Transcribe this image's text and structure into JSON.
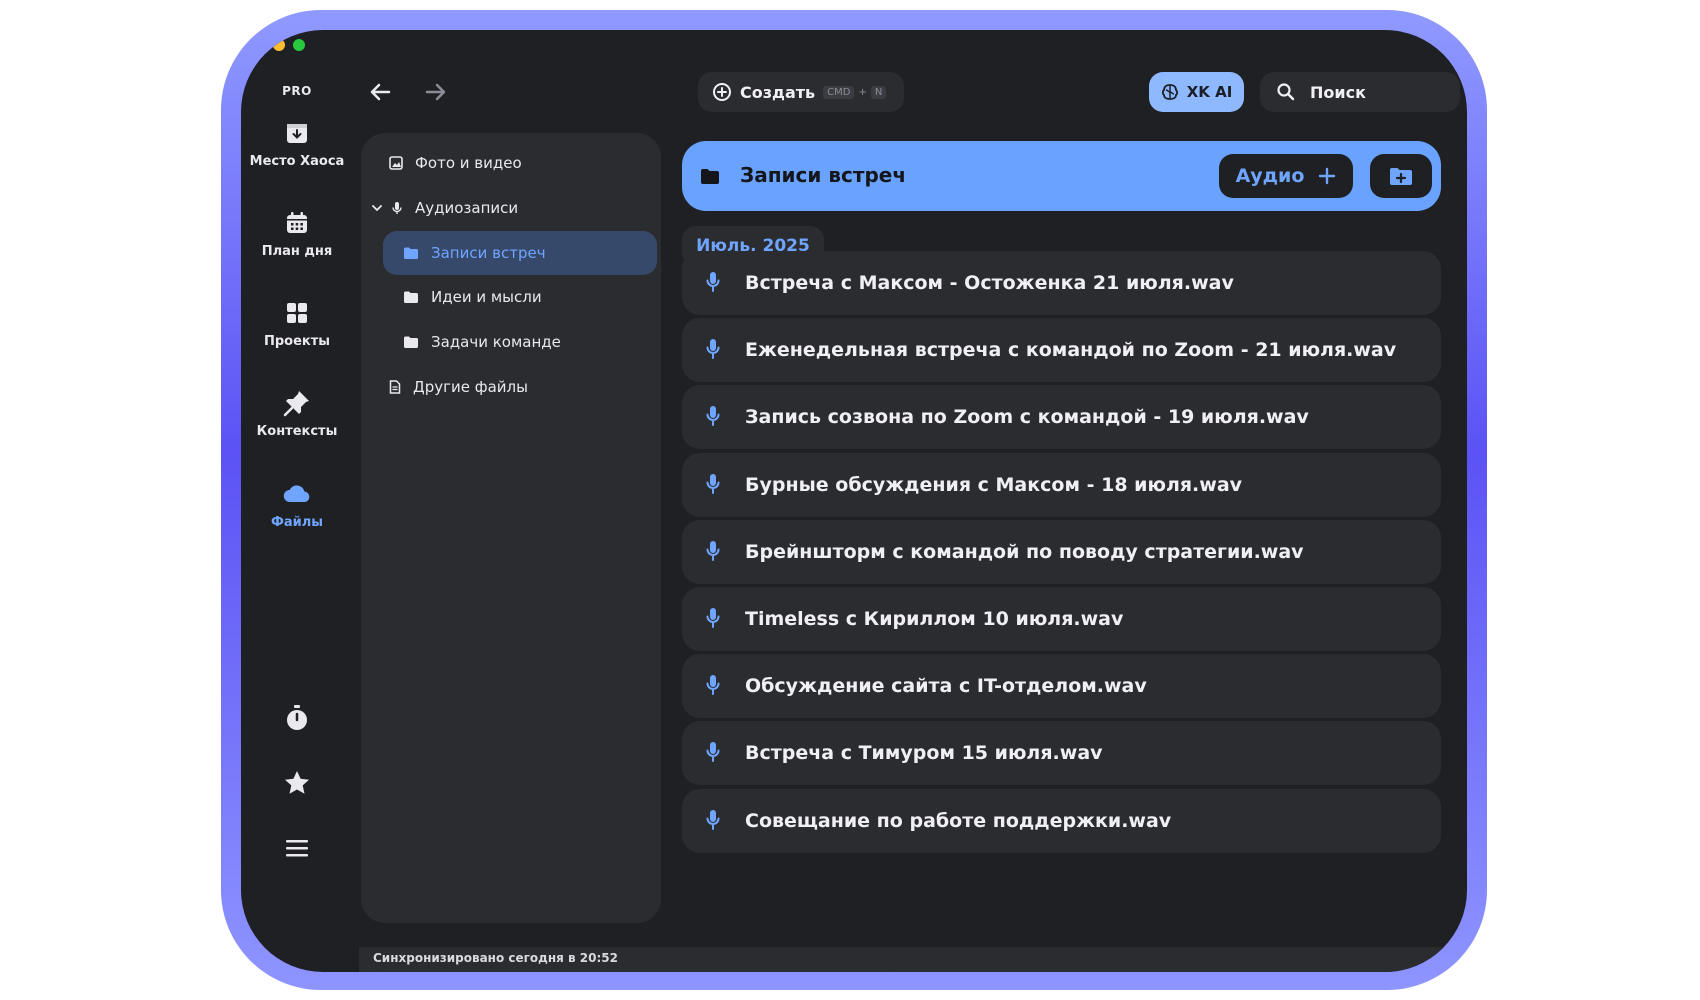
{
  "app": {
    "plan_label": "PRO"
  },
  "rail": {
    "items": [
      {
        "label": "Место Хаоса",
        "icon": "inbox-download-icon"
      },
      {
        "label": "План дня",
        "icon": "calendar-icon"
      },
      {
        "label": "Проекты",
        "icon": "grid-icon"
      },
      {
        "label": "Контексты",
        "icon": "pin-icon"
      },
      {
        "label": "Файлы",
        "icon": "cloud-icon",
        "active": true
      }
    ],
    "bottom_icons": [
      "timer-icon",
      "star-icon",
      "menu-icon"
    ]
  },
  "toolbar": {
    "create_label": "Создать",
    "create_shortcut_key1": "CMD",
    "create_shortcut_plus": "+",
    "create_shortcut_key2": "N",
    "ai_label": "XK AI",
    "search_label": "Поиск"
  },
  "tree": {
    "items": [
      {
        "label": "Фото и видео",
        "icon": "image-icon"
      },
      {
        "label": "Аудиозаписи",
        "icon": "mic-icon",
        "expanded": true
      },
      {
        "label": "Записи встреч",
        "icon": "folder-icon",
        "selected": true
      },
      {
        "label": "Идеи и мысли",
        "icon": "folder-icon"
      },
      {
        "label": "Задачи команде",
        "icon": "folder-icon"
      },
      {
        "label": "Другие файлы",
        "icon": "document-icon"
      }
    ]
  },
  "main": {
    "folder_title": "Записи встреч",
    "audio_button_label": "Аудио",
    "date_group": "Июль, 2025",
    "files": [
      "Встреча с Максом - Остоженка 21 июля.wav",
      "Еженедельная встреча с командой по Zoom - 21 июля.wav",
      "Запись созвона по Zoom с командой - 19 июля.wav",
      "Бурные обсуждения с Максом - 18 июля.wav",
      "Брейншторм с командой по поводу стратегии.wav",
      "Timeless с Кириллом 10 июля.wav",
      "Обсуждение сайта с IT-отделом.wav",
      "Встреча с Тимуром 15 июля.wav",
      "Совещание по работе поддержки.wav"
    ]
  },
  "status_bar": {
    "text": "Синхронизировано сегодня в 20:52"
  },
  "colors": {
    "accent": "#69a3ff",
    "background": "#1f2023",
    "panel": "#2b2c30",
    "frame_gradient": "#5c52f5"
  }
}
